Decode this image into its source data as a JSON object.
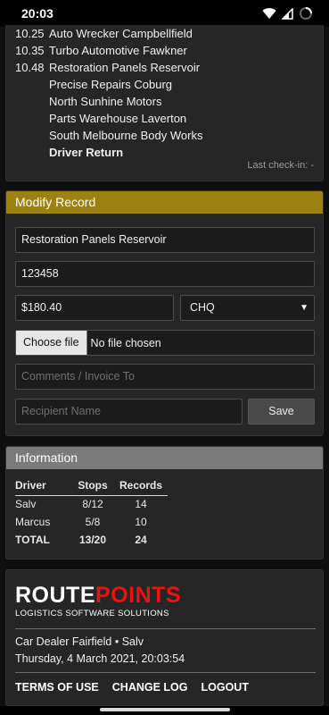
{
  "status_bar": {
    "time": "20:03"
  },
  "stops": [
    {
      "time": "10.25",
      "name": "Auto Wrecker Campbellfield"
    },
    {
      "time": "10.35",
      "name": "Turbo Automotive Fawkner"
    },
    {
      "time": "10.48",
      "name": "Restoration Panels Reservoir"
    },
    {
      "time": "",
      "name": "Precise Repairs Coburg"
    },
    {
      "time": "",
      "name": "North Sunhine Motors"
    },
    {
      "time": "",
      "name": "Parts Warehouse Laverton"
    },
    {
      "time": "",
      "name": "South Melbourne Body Works"
    },
    {
      "time": "",
      "name": "Driver Return"
    }
  ],
  "last_checkin": "Last check-in: -",
  "modify": {
    "title": "Modify Record",
    "business_value": "Restoration Panels Reservoir",
    "number_value": "123458",
    "amount_value": "$180.40",
    "payment_selected": "CHQ",
    "file_button_label": "Choose file",
    "file_status": "No file chosen",
    "comments_placeholder": "Comments / Invoice To",
    "recipient_placeholder": "Recipient Name",
    "save_label": "Save"
  },
  "information": {
    "title": "Information",
    "headers": [
      "Driver",
      "Stops",
      "Records"
    ],
    "rows": [
      {
        "driver": "Salv",
        "stops": "8/12",
        "records": "14"
      },
      {
        "driver": "Marcus",
        "stops": "5/8",
        "records": "10"
      }
    ],
    "total": {
      "driver": "TOTAL",
      "stops": "13/20",
      "records": "24"
    }
  },
  "brand": {
    "logo_part1": "ROUTE",
    "logo_part2": "POINTS",
    "tagline": "LOGISTICS SOFTWARE SOLUTIONS",
    "location": "Car Dealer Fairfield  •  Salv",
    "datetime": "Thursday, 4 March 2021, 20:03:54",
    "links": [
      "TERMS OF USE",
      "CHANGE LOG",
      "LOGOUT"
    ],
    "logo_colors": {
      "route": "#ffffff",
      "points": "#e11111"
    }
  },
  "colors": {
    "modify_header": "#9e8210",
    "info_header": "#7a7a7a",
    "background": "#0f0f0f"
  }
}
